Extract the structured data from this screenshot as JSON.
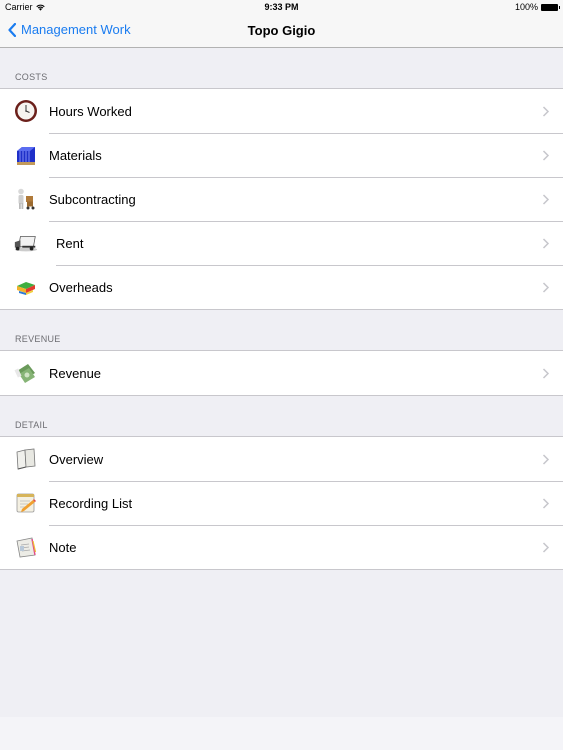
{
  "status_bar": {
    "carrier": "Carrier",
    "time": "9:33 PM",
    "battery": "100%"
  },
  "nav": {
    "back_label": "Management Work",
    "title": "Topo Gigio"
  },
  "sections": [
    {
      "header": "COSTS",
      "items": [
        {
          "label": "Hours Worked",
          "icon": "clock-icon"
        },
        {
          "label": "Materials",
          "icon": "materials-pallet-icon"
        },
        {
          "label": "Subcontracting",
          "icon": "worker-hand-truck-icon"
        },
        {
          "label": "Rent",
          "icon": "truck-icon"
        },
        {
          "label": "Overheads",
          "icon": "stacked-blocks-icon"
        }
      ]
    },
    {
      "header": "REVENUE",
      "items": [
        {
          "label": "Revenue",
          "icon": "money-icon"
        }
      ]
    },
    {
      "header": "DETAIL",
      "items": [
        {
          "label": "Overview",
          "icon": "book-icon"
        },
        {
          "label": "Recording List",
          "icon": "notepad-pencil-icon"
        },
        {
          "label": "Note",
          "icon": "notebook-icon"
        }
      ]
    }
  ],
  "colors": {
    "accent": "#1a7cf0",
    "background": "#efeff4",
    "separator": "#c8c7cc"
  }
}
